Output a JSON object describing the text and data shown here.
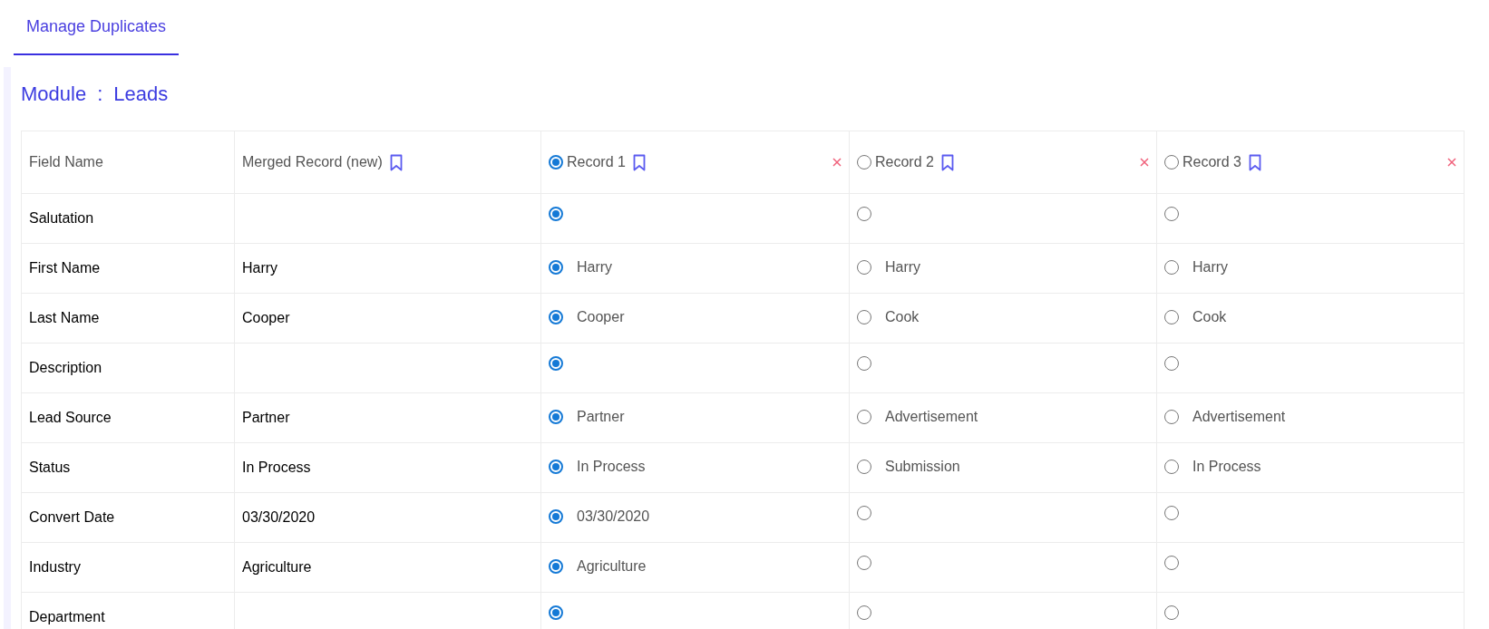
{
  "tabs": [
    {
      "label": "Manage Duplicates",
      "selected": true
    }
  ],
  "module": {
    "label": "Module",
    "separator": ":",
    "name": "Leads"
  },
  "table": {
    "field_header": "Field Name",
    "merged_header": "Merged Record (new)",
    "records": [
      {
        "name": "Record 1",
        "selected": true
      },
      {
        "name": "Record 2",
        "selected": false
      },
      {
        "name": "Record 3",
        "selected": false
      }
    ],
    "rows": [
      {
        "field": "Salutation",
        "values": [
          {
            "selected": true
          },
          {
            "selected": false
          },
          {
            "selected": false
          }
        ]
      },
      {
        "field": "First Name",
        "merged": "Harry",
        "values": [
          {
            "text": "Harry",
            "selected": true
          },
          {
            "text": "Harry",
            "selected": false
          },
          {
            "text": "Harry",
            "selected": false
          }
        ]
      },
      {
        "field": "Last Name",
        "merged": "Cooper",
        "values": [
          {
            "text": "Cooper",
            "selected": true
          },
          {
            "text": "Cook",
            "selected": false
          },
          {
            "text": "Cook",
            "selected": false
          }
        ]
      },
      {
        "field": "Description",
        "values": [
          {
            "selected": true
          },
          {
            "selected": false
          },
          {
            "selected": false
          }
        ]
      },
      {
        "field": "Lead Source",
        "merged": "Partner",
        "values": [
          {
            "text": "Partner",
            "selected": true
          },
          {
            "text": "Advertisement",
            "selected": false
          },
          {
            "text": "Advertisement",
            "selected": false
          }
        ]
      },
      {
        "field": "Status",
        "merged": "In Process",
        "values": [
          {
            "text": "In Process",
            "selected": true
          },
          {
            "text": "Submission",
            "selected": false
          },
          {
            "text": "In Process",
            "selected": false
          }
        ]
      },
      {
        "field": "Convert Date",
        "merged": "03/30/2020",
        "values": [
          {
            "text": "03/30/2020",
            "selected": true
          },
          {
            "selected": false
          },
          {
            "selected": false
          }
        ]
      },
      {
        "field": "Industry",
        "merged": "Agriculture",
        "values": [
          {
            "text": "Agriculture",
            "selected": true
          },
          {
            "selected": false
          },
          {
            "selected": false
          }
        ]
      },
      {
        "field": "Department",
        "values": [
          {
            "selected": true
          },
          {
            "selected": false
          },
          {
            "selected": false
          }
        ]
      }
    ]
  }
}
